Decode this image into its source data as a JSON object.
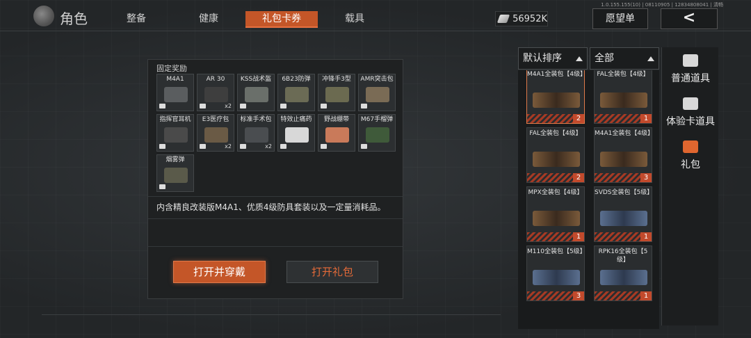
{
  "version_text": "1.0.155.155(10) | 08110905 | 12834808041 | 清畅",
  "header": {
    "title": "角色",
    "tabs": [
      {
        "label": "整备"
      },
      {
        "label": "健康"
      },
      {
        "label": "礼包卡券",
        "active": true
      },
      {
        "label": "载具"
      }
    ],
    "currency": "56952K",
    "wishlist_label": "愿望单",
    "back_label": "<"
  },
  "reward_panel": {
    "title": "固定奖励",
    "items": [
      {
        "name": "M4A1",
        "count": ""
      },
      {
        "name": "AR 30",
        "count": "x2"
      },
      {
        "name": "KSS战术盔",
        "count": ""
      },
      {
        "name": "6B23防弹",
        "count": ""
      },
      {
        "name": "冲锋手3型",
        "count": ""
      },
      {
        "name": "AMR突击包",
        "count": ""
      },
      {
        "name": "指挥官耳机",
        "count": ""
      },
      {
        "name": "E3医疗包",
        "count": "x2"
      },
      {
        "name": "标准手术包",
        "count": "x2"
      },
      {
        "name": "特效止痛药",
        "count": ""
      },
      {
        "name": "野战绷带",
        "count": ""
      },
      {
        "name": "M67手榴弹",
        "count": ""
      },
      {
        "name": "烟雾弹",
        "count": ""
      }
    ],
    "description": "内含精良改装版M4A1、优质4级防具套装以及一定量消耗品。",
    "open_equip_label": "打开并穿戴",
    "open_label": "打开礼包"
  },
  "list_panel": {
    "sort_label": "默认排序",
    "filter_label": "全部",
    "cards": [
      {
        "name": "M4A1全装包【4级】",
        "count": "2",
        "selected": true
      },
      {
        "name": "FAL全装包【4级】",
        "count": "1",
        "selected": false
      },
      {
        "name": "FAL全装包【4级】",
        "count": "2",
        "selected": false
      },
      {
        "name": "M4A1全装包【4级】",
        "count": "3",
        "selected": false
      },
      {
        "name": "MPX全装包【4级】",
        "count": "1",
        "selected": false
      },
      {
        "name": "SVDS全装包【5级】",
        "count": "1",
        "selected": false
      },
      {
        "name": "M110全装包【5级】",
        "count": "3",
        "selected": false
      },
      {
        "name": "RPK16全装包【5级】",
        "count": "1",
        "selected": false
      }
    ]
  },
  "side_tabs": [
    {
      "label": "普通道具",
      "icon": "chest-icon"
    },
    {
      "label": "体验卡道具",
      "icon": "card-icon"
    },
    {
      "label": "礼包",
      "icon": "gift-icon"
    }
  ]
}
